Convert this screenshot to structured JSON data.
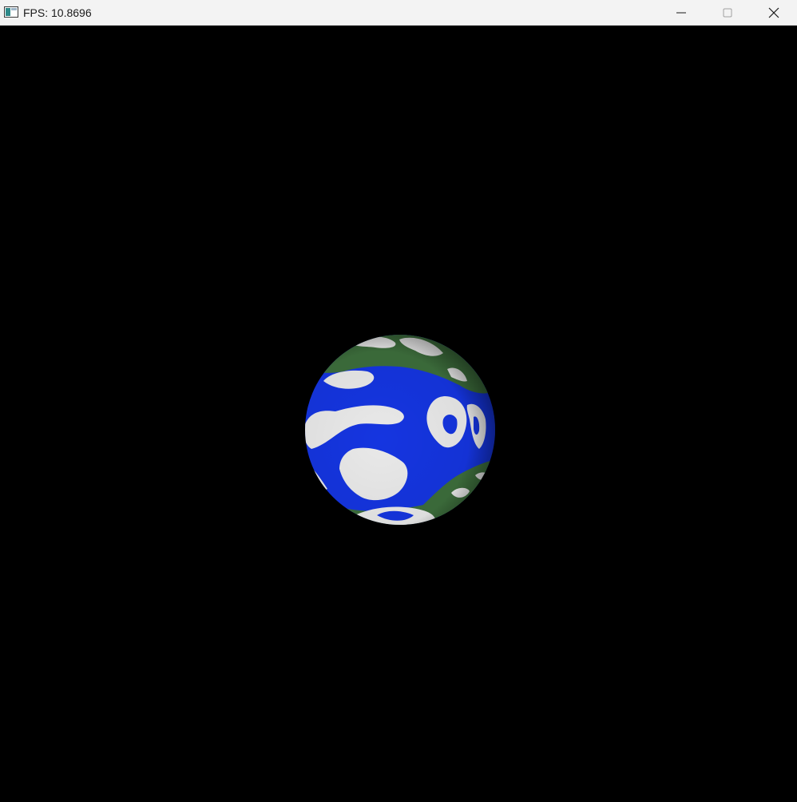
{
  "window": {
    "title": "FPS: 10.8696",
    "background_color": "#000000",
    "titlebar_color": "#f3f3f3"
  },
  "titlebar": {
    "app_icon": "app-window-icon",
    "minimize_icon": "minimize-icon",
    "maximize_icon": "maximize-icon",
    "close_icon": "close-icon"
  },
  "scene": {
    "object": "rotating-sphere",
    "colors": {
      "water": "#1535e0",
      "land": "#3d6e3c",
      "ice": "#e9e9e9",
      "space": "#000000"
    }
  }
}
